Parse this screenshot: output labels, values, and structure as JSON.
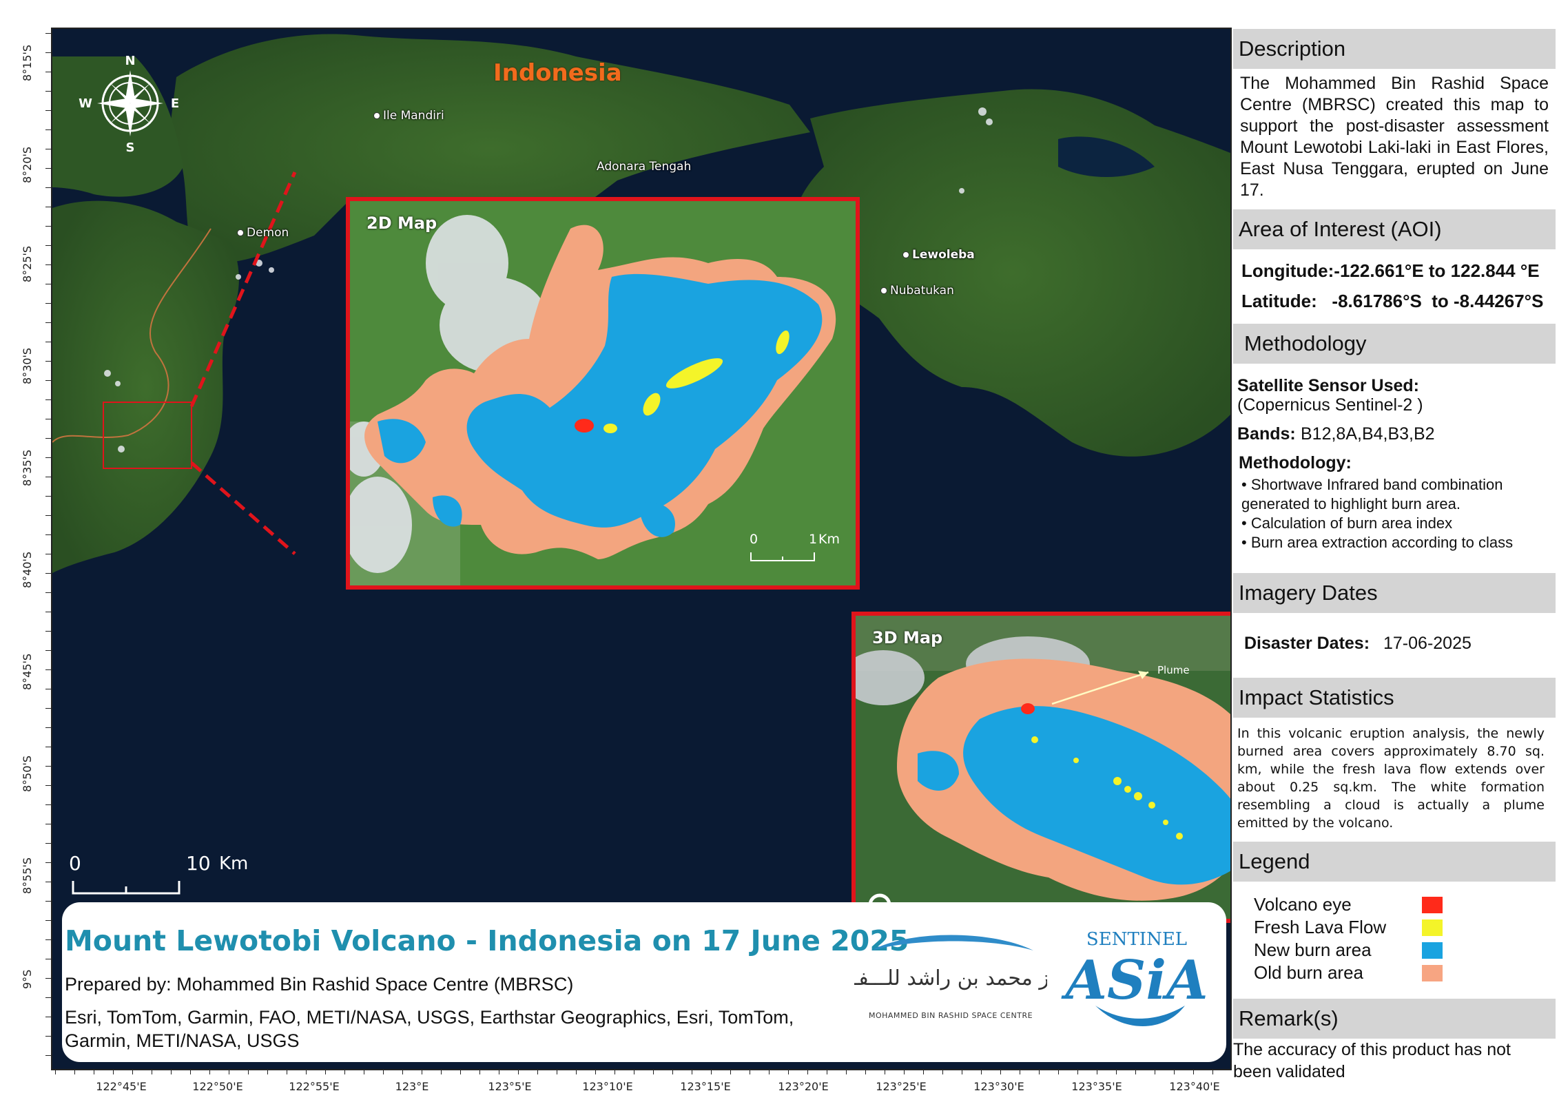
{
  "map": {
    "country_label": "Indonesia",
    "places": [
      {
        "name": "Ile Mandiri"
      },
      {
        "name": "Adonara Tengah"
      },
      {
        "name": "Demon"
      },
      {
        "name": "Lewoleba"
      },
      {
        "name": "Nubatukan"
      }
    ],
    "compass": {
      "n": "N",
      "s": "S",
      "e": "E",
      "w": "W"
    },
    "scale_bar": {
      "start": "0",
      "end": "10",
      "unit": "Km"
    },
    "inset_2d": {
      "title": "2D Map",
      "scale_start": "0",
      "scale_end": "1",
      "scale_unit": "Km"
    },
    "inset_3d": {
      "title": "3D Map",
      "plume_label": "Plume"
    },
    "lat_labels": [
      "8°15'S",
      "8°20'S",
      "8°25'S",
      "8°30'S",
      "8°35'S",
      "8°40'S",
      "8°45'S",
      "8°50'S",
      "8°55'S",
      "9°S"
    ],
    "lon_labels": [
      "122°45'E",
      "122°50'E",
      "122°55'E",
      "123°E",
      "123°5'E",
      "123°10'E",
      "123°15'E",
      "123°20'E",
      "123°25'E",
      "123°30'E",
      "123°35'E",
      "123°40'E"
    ]
  },
  "title_box": {
    "title": "Mount Lewotobi  Volcano - Indonesia on 17 June 2025",
    "prepared_by": "Prepared by: Mohammed Bin Rashid Space Centre (MBRSC)",
    "credits": "Esri, TomTom, Garmin, FAO, METI/NASA, USGS, Earthstar Geographics, Esri, TomTom, Garmin, METI/NASA, USGS",
    "mbrsc_arabic": "مـــركز محمد بن راشد للـــفـضـــاء",
    "mbrsc_english": "MOHAMMED BIN RASHID SPACE CENTRE",
    "sentinel_text": "SENTINEL",
    "sentinel_asia": "ASiA"
  },
  "panel": {
    "description": {
      "heading": "Description",
      "text": "The Mohammed Bin Rashid Space Centre (MBRSC) created this map to support the post-disaster assessment Mount Lewotobi Laki-laki in East Flores, East Nusa Tenggara, erupted on June 17."
    },
    "aoi": {
      "heading": "Area of Interest (AOI)",
      "longitude": "Longitude:-122.661°E  to 122.844 °E",
      "latitude": "Latitude:   -8.61786°S  to -8.44267°S"
    },
    "methodology": {
      "heading": "Methodology",
      "sensor_label": "Satellite Sensor Used:",
      "sensor_value": "(Copernicus Sentinel-2 )",
      "bands_label": "Bands:",
      "bands_value": "B12,8A,B4,B3,B2",
      "method_label": "Methodology:",
      "bullets": [
        "• Shortwave Infrared band combination generated to highlight burn area.",
        "• Calculation of burn area index",
        "• Burn area extraction according to class"
      ]
    },
    "imagery": {
      "heading": "Imagery Dates",
      "label": "Disaster Dates:",
      "value": "17-06-2025"
    },
    "impact": {
      "heading": "Impact Statistics",
      "text": "In this volcanic eruption analysis, the newly burned area covers approximately 8.70 sq. km, while the fresh lava flow extends over about 0.25 sq.km. The white formation resembling a cloud is actually a plume emitted by the volcano."
    },
    "legend": {
      "heading": "Legend",
      "items": [
        {
          "label": "Volcano eye",
          "color": "#ff2a1a"
        },
        {
          "label": "Fresh Lava Flow",
          "color": "#f4f429"
        },
        {
          "label": "New burn area",
          "color": "#1aa3e0"
        },
        {
          "label": "Old burn area",
          "color": "#f7a582"
        }
      ]
    },
    "remarks": {
      "heading": "Remark(s)",
      "text": "The accuracy of this product has not been validated"
    }
  }
}
